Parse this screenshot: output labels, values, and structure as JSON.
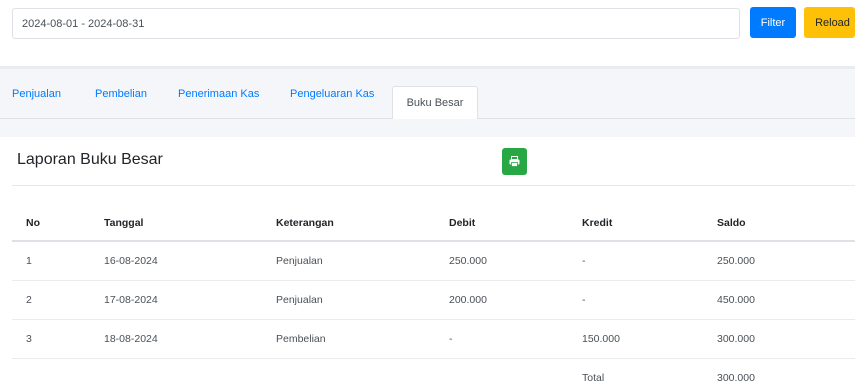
{
  "filter": {
    "date_range_value": "2024-08-01 - 2024-08-31",
    "filter_label": "Filter",
    "reload_label": "Reload"
  },
  "tabs": [
    {
      "label": "Penjualan",
      "active": false
    },
    {
      "label": "Pembelian",
      "active": false
    },
    {
      "label": "Penerimaan Kas",
      "active": false
    },
    {
      "label": "Pengeluaran Kas",
      "active": false
    },
    {
      "label": "Buku Besar",
      "active": true
    }
  ],
  "report": {
    "title": "Laporan Buku Besar",
    "print_icon": "print-icon",
    "print_color": "#28a745"
  },
  "table": {
    "headers": {
      "no": "No",
      "tanggal": "Tanggal",
      "keterangan": "Keterangan",
      "debit": "Debit",
      "kredit": "Kredit",
      "saldo": "Saldo"
    },
    "rows": [
      {
        "no": "1",
        "tanggal": "16-08-2024",
        "keterangan": "Penjualan",
        "debit": "250.000",
        "kredit": "-",
        "saldo": "250.000"
      },
      {
        "no": "2",
        "tanggal": "17-08-2024",
        "keterangan": "Penjualan",
        "debit": "200.000",
        "kredit": "-",
        "saldo": "450.000"
      },
      {
        "no": "3",
        "tanggal": "18-08-2024",
        "keterangan": "Pembelian",
        "debit": "-",
        "kredit": "150.000",
        "saldo": "300.000"
      }
    ],
    "total_label": "Total",
    "total_value": "300.000"
  },
  "colors": {
    "primary": "#007bff",
    "warning": "#ffc107",
    "success": "#28a745"
  }
}
